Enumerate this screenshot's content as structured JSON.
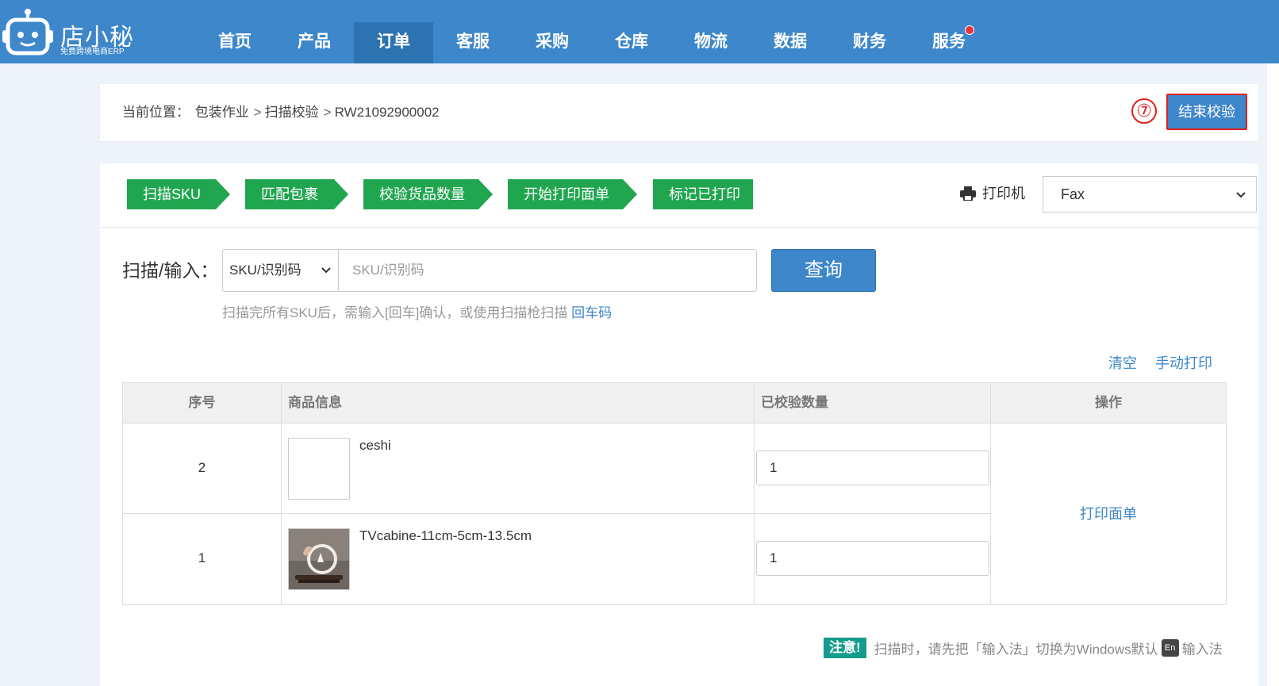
{
  "brand": {
    "name": "店小秘",
    "tagline": "免费跨境电商ERP"
  },
  "nav": {
    "items": [
      "首页",
      "产品",
      "订单",
      "客服",
      "采购",
      "仓库",
      "物流",
      "数据",
      "财务",
      "服务"
    ],
    "active_index": 2
  },
  "breadcrumb": {
    "label": "当前位置：",
    "parts": [
      "包装作业",
      "扫描校验",
      "RW21092900002"
    ],
    "separator": ">"
  },
  "actions": {
    "step_marker": "⑦",
    "end_check": "结束校验"
  },
  "steps": [
    "扫描SKU",
    "匹配包裹",
    "校验货品数量",
    "开始打印面单",
    "标记已打印"
  ],
  "printer": {
    "label": "打印机",
    "selected": "Fax"
  },
  "scan": {
    "label": "扫描/输入：",
    "type_selected": "SKU/识别码",
    "placeholder": "SKU/识别码",
    "query_button": "查询",
    "hint_text": "扫描完所有SKU后，需输入[回车]确认，或使用扫描枪扫描 ",
    "hint_link": "回车码"
  },
  "table_links": {
    "clear": "清空",
    "manual_print": "手动打印"
  },
  "table": {
    "headers": [
      "序号",
      "商品信息",
      "已校验数量",
      "操作"
    ],
    "rows": [
      {
        "seq": "2",
        "name": "ceshi",
        "qty": "1",
        "image": "blank"
      },
      {
        "seq": "1",
        "name": "TVcabine-11cm-5cm-13.5cm",
        "qty": "1",
        "image": "product-photo"
      }
    ],
    "operation": "打印面单"
  },
  "notice": {
    "tag": "注意!",
    "text_before": "扫描时，请先把「输入法」切换为Windows默认",
    "badge": "En",
    "text_after": "输入法"
  },
  "colors": {
    "nav_bg": "#3d87ca",
    "nav_active": "#2d72b1",
    "step_green": "#21a650",
    "link_blue": "#3d87ca",
    "highlight_red": "#e02020",
    "notice_teal": "#149c8c"
  }
}
